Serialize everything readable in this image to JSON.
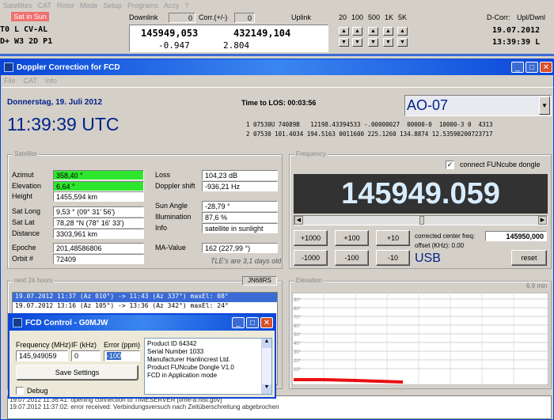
{
  "top": {
    "menus": [
      "Satellites",
      "CAT",
      "Rotor",
      "Mode",
      "Setup",
      "Programs",
      "Accy",
      "?"
    ],
    "sat_in_sun": "Sat in Sun",
    "left_line1": "T0 L CV-AL",
    "left_line2": "D+ W3 2D P1",
    "downlink_label": "Downlink",
    "downlink_count": "0",
    "corr_label": "Corr.(+/-)",
    "corr_count": "0",
    "uplink_label": "Uplink",
    "downlink_freq": "145949,053",
    "uplink_freq": "432149,104",
    "corr_down": "-0.947",
    "corr_up": "2.804",
    "steps": [
      "20",
      "100",
      "500",
      "1K",
      "5K"
    ],
    "dcorr_label": "D-Corr:",
    "updwnl_label": "Upl/Dwnl",
    "date": "19.07.2012",
    "time": "13:39:39 L"
  },
  "main": {
    "title": "Doppler Correction for FCD",
    "menus": [
      "File",
      "CAT",
      "Info"
    ],
    "date": "Donnerstag, 19. Juli 2012",
    "utc": "11:39:39 UTC",
    "los": "Time to LOS: 00:03:56",
    "satellite": "AO-07",
    "tle1": "1 07530U 74089B   12198.43394533 -.00000027  00000-0  10000-3 0  4313",
    "tle2": "2 07530 101.4034 194.5163 0011600 225.1260 134.8874 12.53590200723717"
  },
  "satellite": {
    "group": "Satellite",
    "azimut_label": "Azimut",
    "azimut": "358,40 °",
    "elevation_label": "Elevation",
    "elevation": "6,64 °",
    "height_label": "Height",
    "height": "1455,594 km",
    "satlong_label": "Sat Long",
    "satlong": "9,53 °  (09° 31' 56')",
    "satlat_label": "Sat Lat",
    "satlat": "78,28 °N  (78° 16' 33')",
    "distance_label": "Distance",
    "distance": "3303,961 km",
    "epoche_label": "Epoche",
    "epoche": "201,48586806",
    "orbit_label": "Orbit #",
    "orbit": "72409",
    "loss_label": "Loss",
    "loss": "104,23 dB",
    "doppler_label": "Doppler shift",
    "doppler": "-936,21 Hz",
    "sunangle_label": "Sun Angle",
    "sunangle": "-28,79 °",
    "illum_label": "Illumination",
    "illum": "87,6 %",
    "info_label": "Info",
    "info": "satellite in sunlight",
    "ma_label": "MA-Value",
    "ma": "162  (227,99 °)",
    "tle_age": "TLE's are 3,1 days old"
  },
  "frequency": {
    "group": "Frequency",
    "connect_label": "connect FUNcube dongle",
    "display": "145949.059",
    "plus": [
      "+1000",
      "+100",
      "+10"
    ],
    "minus": [
      "-1000",
      "-100",
      "-10"
    ],
    "center_label": "corrected center freq:",
    "center": "145950,000",
    "offset_label": "offset (KHz): 0,00",
    "mode": "USB",
    "reset": "reset"
  },
  "passes": {
    "group": "next 24 hours",
    "locator": "JN68RS",
    "rows": [
      "19.07.2012 11:37 (Az 010°) -> 11:43 (Az 337°) maxEl: 08°",
      "19.07.2012 13:16 (Az 105°) -> 13:36 (Az 342°) maxEl: 24°"
    ]
  },
  "elevation": {
    "group": "Elevation",
    "minutes": "6,9 min",
    "ticks": [
      "90°",
      "80°",
      "70°",
      "60°",
      "50°",
      "40°",
      "30°",
      "20°",
      "10°"
    ]
  },
  "fcd": {
    "title": "FCD Control - G0MJW",
    "freq_label": "Frequency (MHz)",
    "if_label": "IF (kHz)",
    "error_label": "Error (ppm)",
    "freq": "145,949059",
    "if": "0",
    "error": "-100",
    "save": "Save Settings",
    "debug": "Debug",
    "info": [
      "Product ID 64342",
      "Serial Number 1033",
      "Manufacturer Hanlincrest Ltd.",
      "Product FUNcube Dongle V1.0",
      "FCD in Application mode"
    ]
  },
  "log": [
    "19.07.2012 11:36:41: opening connection to TIMESERVER [time-a.nist.gov]",
    "19.07.2012 11:37:02: error received: Verbindungsversuch nach Zeitüberschreitung abgebrochen"
  ]
}
